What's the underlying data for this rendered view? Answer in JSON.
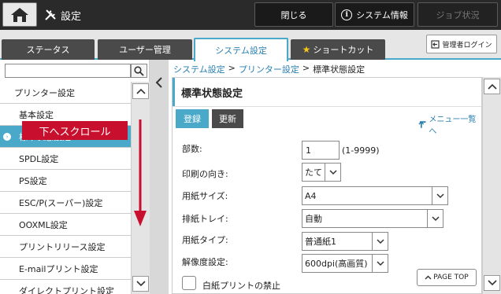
{
  "header": {
    "title": "設定",
    "close_label": "閉じる",
    "system_info_label": "システム情報",
    "job_status_label": "ジョブ状況"
  },
  "tabs": [
    {
      "label": "ステータス"
    },
    {
      "label": "ユーザー管理"
    },
    {
      "label": "システム設定"
    },
    {
      "label": "ショートカット"
    }
  ],
  "admin_login_label": "管理者ログイン",
  "sidebar": {
    "search_value": "",
    "items": [
      {
        "label": "プリンター設定"
      },
      {
        "label": "基本設定"
      },
      {
        "label": "標準状態設定"
      },
      {
        "label": "SPDL設定"
      },
      {
        "label": "PS設定"
      },
      {
        "label": "ESC/P(スーパー)設定"
      },
      {
        "label": "OOXML設定"
      },
      {
        "label": "プリントリリース設定"
      },
      {
        "label": "E-mailプリント設定"
      },
      {
        "label": "ダイレクトプリント設定"
      }
    ],
    "scroll_hint": "下へスクロール"
  },
  "breadcrumb": {
    "item1": "システム設定",
    "item2": "プリンター設定",
    "current": "標準状態設定",
    "sep": ">"
  },
  "panel": {
    "title": "標準状態設定",
    "register_label": "登録",
    "update_label": "更新",
    "menu_list_label": "メニュー一覧へ",
    "copies_label": "部数:",
    "copies_value": "1",
    "copies_range": "(1-9999)",
    "orientation_label": "印刷の向き:",
    "orientation_value": "たて",
    "paper_size_label": "用紙サイズ:",
    "paper_size_value": "A4",
    "output_tray_label": "排紙トレイ:",
    "output_tray_value": "自動",
    "paper_type_label": "用紙タイプ:",
    "paper_type_value": "普通紙1",
    "resolution_label": "解像度設定:",
    "resolution_value": "600dpi(高画質)",
    "blank_print_label": "白紙プリントの禁止",
    "page_top_label": "PAGE TOP"
  }
}
